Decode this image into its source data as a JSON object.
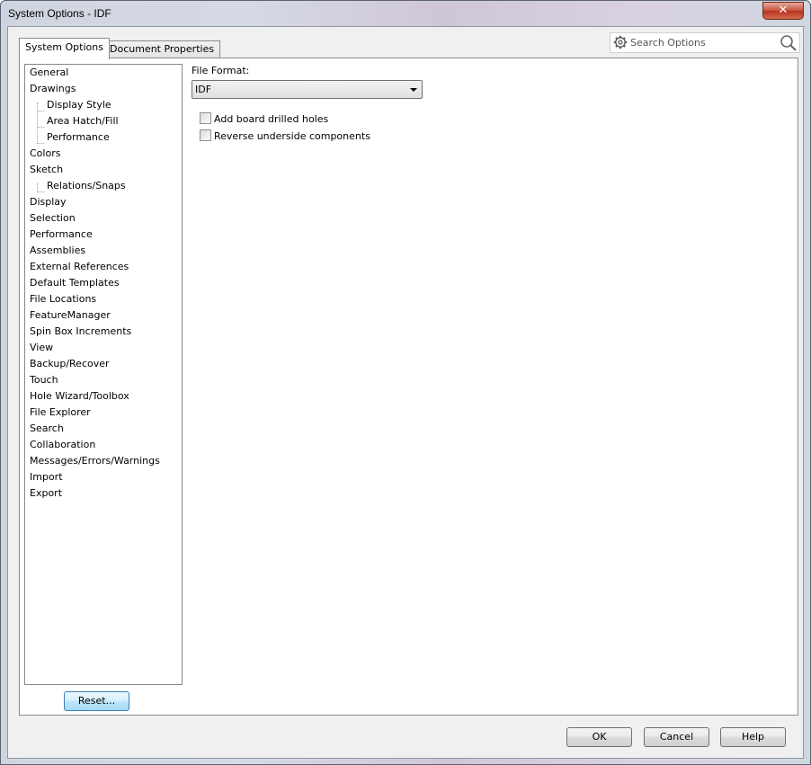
{
  "window": {
    "title": "System Options - IDF",
    "close_glyph": "✕"
  },
  "tabs": [
    {
      "label": "System Options",
      "active": true
    },
    {
      "label": "Document Properties",
      "active": false
    }
  ],
  "search": {
    "placeholder": "Search Options",
    "icon_left": "gear-icon",
    "icon_right": "magnifier-icon"
  },
  "tree": {
    "items": [
      {
        "label": "General",
        "level": 0
      },
      {
        "label": "Drawings",
        "level": 0
      },
      {
        "label": "Display Style",
        "level": 1
      },
      {
        "label": "Area Hatch/Fill",
        "level": 1
      },
      {
        "label": "Performance",
        "level": 1
      },
      {
        "label": "Colors",
        "level": 0
      },
      {
        "label": "Sketch",
        "level": 0
      },
      {
        "label": "Relations/Snaps",
        "level": 1
      },
      {
        "label": "Display",
        "level": 0
      },
      {
        "label": "Selection",
        "level": 0
      },
      {
        "label": "Performance",
        "level": 0
      },
      {
        "label": "Assemblies",
        "level": 0
      },
      {
        "label": "External References",
        "level": 0
      },
      {
        "label": "Default Templates",
        "level": 0
      },
      {
        "label": "File Locations",
        "level": 0
      },
      {
        "label": "FeatureManager",
        "level": 0
      },
      {
        "label": "Spin Box Increments",
        "level": 0
      },
      {
        "label": "View",
        "level": 0
      },
      {
        "label": "Backup/Recover",
        "level": 0
      },
      {
        "label": "Touch",
        "level": 0
      },
      {
        "label": "Hole Wizard/Toolbox",
        "level": 0
      },
      {
        "label": "File Explorer",
        "level": 0
      },
      {
        "label": "Search",
        "level": 0
      },
      {
        "label": "Collaboration",
        "level": 0
      },
      {
        "label": "Messages/Errors/Warnings",
        "level": 0
      },
      {
        "label": "Import",
        "level": 0
      },
      {
        "label": "Export",
        "level": 0
      }
    ]
  },
  "reset_label": "Reset...",
  "file_format": {
    "label": "File Format:",
    "value": "IDF"
  },
  "options": [
    {
      "label": "Add board drilled holes",
      "checked": false
    },
    {
      "label": "Reverse underside components",
      "checked": false
    }
  ],
  "footer": {
    "ok_label": "OK",
    "cancel_label": "Cancel",
    "help_label": "Help"
  },
  "colors": {
    "reset_border": "#3c7fb1",
    "close_button": "#c7523c"
  }
}
